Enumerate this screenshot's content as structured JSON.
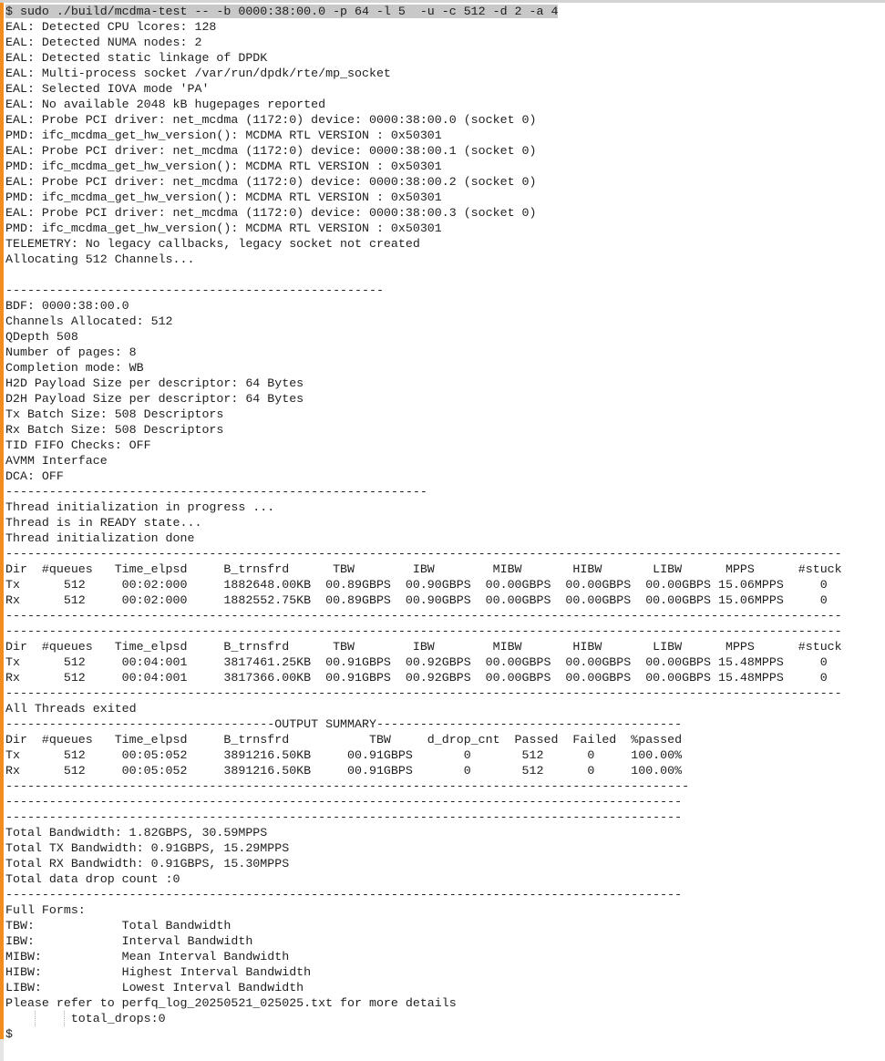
{
  "terminal": {
    "command_line": "$ sudo ./build/mcdma-test -- -b 0000:38:00.0 -p 64 -l 5  -u -c 512 -d 2 -a 4",
    "lines": [
      "EAL: Detected CPU lcores: 128",
      "EAL: Detected NUMA nodes: 2",
      "EAL: Detected static linkage of DPDK",
      "EAL: Multi-process socket /var/run/dpdk/rte/mp_socket",
      "EAL: Selected IOVA mode 'PA'",
      "EAL: No available 2048 kB hugepages reported",
      "EAL: Probe PCI driver: net_mcdma (1172:0) device: 0000:38:00.0 (socket 0)",
      "PMD: ifc_mcdma_get_hw_version(): MCDMA RTL VERSION : 0x50301",
      "EAL: Probe PCI driver: net_mcdma (1172:0) device: 0000:38:00.1 (socket 0)",
      "PMD: ifc_mcdma_get_hw_version(): MCDMA RTL VERSION : 0x50301",
      "EAL: Probe PCI driver: net_mcdma (1172:0) device: 0000:38:00.2 (socket 0)",
      "PMD: ifc_mcdma_get_hw_version(): MCDMA RTL VERSION : 0x50301",
      "EAL: Probe PCI driver: net_mcdma (1172:0) device: 0000:38:00.3 (socket 0)",
      "PMD: ifc_mcdma_get_hw_version(): MCDMA RTL VERSION : 0x50301",
      "TELEMETRY: No legacy callbacks, legacy socket not created",
      "Allocating 512 Channels...",
      "",
      "----------------------------------------------------",
      "BDF: 0000:38:00.0",
      "Channels Allocated: 512",
      "QDepth 508",
      "Number of pages: 8",
      "Completion mode: WB",
      "H2D Payload Size per descriptor: 64 Bytes",
      "D2H Payload Size per descriptor: 64 Bytes",
      "Tx Batch Size: 508 Descriptors",
      "Rx Batch Size: 508 Descriptors",
      "TID FIFO Checks: OFF",
      "AVMM Interface",
      "DCA: OFF",
      "----------------------------------------------------------",
      "Thread initialization in progress ...",
      "Thread is in READY state...",
      "Thread initialization done",
      "-------------------------------------------------------------------------------------------------------------------",
      "Dir  #queues   Time_elpsd     B_trnsfrd      TBW        IBW        MIBW       HIBW       LIBW      MPPS      #stuck",
      "Tx      512     00:02:000     1882648.00KB  00.89GBPS  00.90GBPS  00.00GBPS  00.00GBPS  00.00GBPS 15.06MPPS     0",
      "Rx      512     00:02:000     1882552.75KB  00.89GBPS  00.90GBPS  00.00GBPS  00.00GBPS  00.00GBPS 15.06MPPS     0",
      "-------------------------------------------------------------------------------------------------------------------",
      "-------------------------------------------------------------------------------------------------------------------",
      "Dir  #queues   Time_elpsd     B_trnsfrd      TBW        IBW        MIBW       HIBW       LIBW      MPPS      #stuck",
      "Tx      512     00:04:001     3817461.25KB  00.91GBPS  00.92GBPS  00.00GBPS  00.00GBPS  00.00GBPS 15.48MPPS     0",
      "Rx      512     00:04:001     3817366.00KB  00.91GBPS  00.92GBPS  00.00GBPS  00.00GBPS  00.00GBPS 15.48MPPS     0",
      "-------------------------------------------------------------------------------------------------------------------",
      "All Threads exited",
      "-------------------------------------OUTPUT SUMMARY------------------------------------------",
      "Dir  #queues   Time_elpsd     B_trnsfrd           TBW     d_drop_cnt  Passed  Failed  %passed",
      "Tx      512     00:05:052     3891216.50KB     00.91GBPS       0       512      0     100.00%",
      "Rx      512     00:05:052     3891216.50KB     00.91GBPS       0       512      0     100.00%",
      "----------------------------------------------------------------------------------------------",
      "---------------------------------------------------------------------------------------------",
      "---------------------------------------------------------------------------------------------",
      "Total Bandwidth: 1.82GBPS, 30.59MPPS",
      "Total TX Bandwidth: 0.91GBPS, 15.29MPPS",
      "Total RX Bandwidth: 0.91GBPS, 15.30MPPS",
      "Total data drop count :0",
      "---------------------------------------------------------------------------------------------",
      "Full Forms:",
      "TBW:            Total Bandwidth",
      "IBW:            Interval Bandwidth",
      "MIBW:           Mean Interval Bandwidth",
      "HIBW:           Highest Interval Bandwidth",
      "LIBW:           Lowest Interval Bandwidth",
      "Please refer to perfq_log_20250521_025025.txt for more details",
      "         total_drops:0",
      "$"
    ]
  }
}
